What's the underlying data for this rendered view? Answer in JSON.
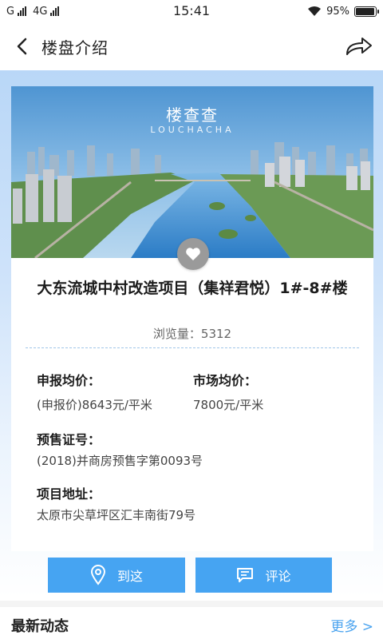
{
  "status_bar": {
    "carrier_left": "G",
    "network": "4G",
    "time": "15:41",
    "battery": "95%"
  },
  "nav": {
    "title": "楼盘介绍"
  },
  "hero": {
    "title": "楼查查",
    "subtitle": "LOUCHACHA"
  },
  "project": {
    "name": "大东流城中村改造项目（集祥君悦）1#-8#楼",
    "views_label": "浏览量：",
    "views_count": "5312"
  },
  "details": {
    "declared_price_label": "申报均价：",
    "declared_price_value": "(申报价)8643元/平米",
    "market_price_label": "市场均价：",
    "market_price_value": "7800元/平米",
    "presale_label": "预售证号：",
    "presale_value": "(2018)并商房预售字第0093号",
    "address_label": "项目地址：",
    "address_value": "太原市尖草坪区汇丰南街79号"
  },
  "actions": {
    "navigate_label": "到这",
    "comment_label": "评论"
  },
  "latest": {
    "title": "最新动态",
    "more_label": "更多 >"
  },
  "colors": {
    "accent": "#46a4f2",
    "link": "#4aa3ef",
    "background_gradient_top": "#b9d7f7"
  }
}
